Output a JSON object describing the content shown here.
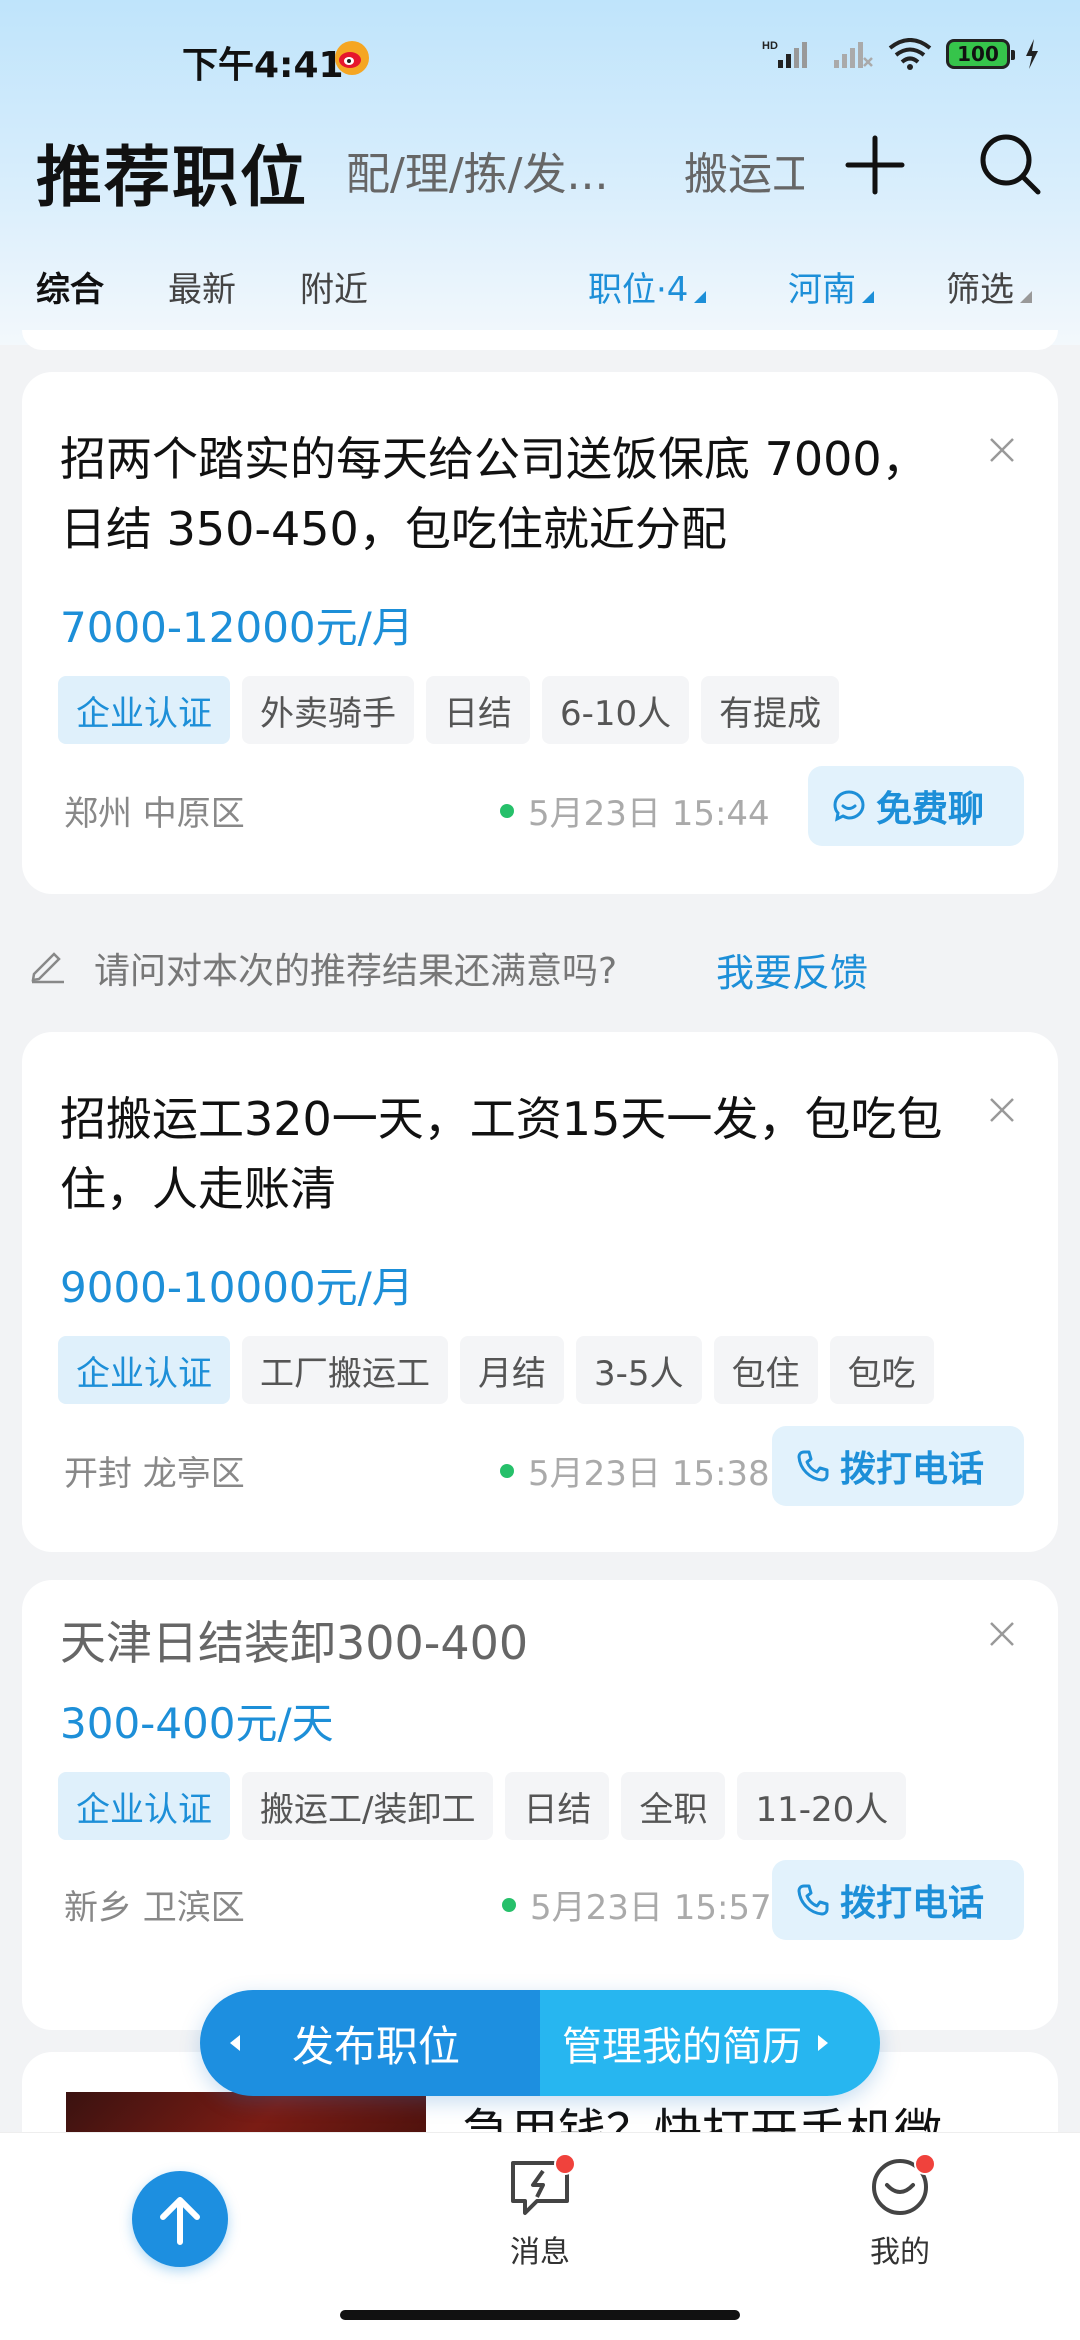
{
  "status_bar": {
    "time": "下午4:41",
    "network_label": "HD",
    "battery": "100",
    "icons": [
      "weibo-icon",
      "signal-icon",
      "signal-x-icon",
      "wifi-icon",
      "battery-icon",
      "charging-icon"
    ]
  },
  "header": {
    "title": "推荐职位",
    "tabs": [
      "配/理/拣/发...",
      "搬运工"
    ],
    "add_icon": "plus-icon",
    "search_icon": "search-icon"
  },
  "filters": {
    "sort_tabs": [
      "综合",
      "最新",
      "附近"
    ],
    "position": "职位·4",
    "region": "河南",
    "filter": "筛选"
  },
  "jobs": [
    {
      "title": "招两个踏实的每天给公司送饭保底 7000，日结 350-450，包吃住就近分配",
      "salary": "7000-12000元/月",
      "tags": [
        "企业认证",
        "外卖骑手",
        "日结",
        "6-10人",
        "有提成"
      ],
      "location": "郑州 中原区",
      "time": "5月23日 15:44",
      "action": "免费聊"
    },
    {
      "title": "招搬运工320一天，工资15天一发，包吃包住，人走账清",
      "salary": "9000-10000元/月",
      "tags": [
        "企业认证",
        "工厂搬运工",
        "月结",
        "3-5人",
        "包住",
        "包吃"
      ],
      "location": "开封 龙亭区",
      "time": "5月23日 15:38",
      "action": "拨打电话"
    },
    {
      "title": "天津日结装卸300-400",
      "salary": "300-400元/天",
      "tags": [
        "企业认证",
        "搬运工/装卸工",
        "日结",
        "全职",
        "11-20人"
      ],
      "location": "新乡 卫滨区",
      "time": "5月23日 15:57",
      "action": "拨打电话"
    }
  ],
  "feedback": {
    "question": "请问对本次的推荐结果还满意吗?",
    "link": "我要反馈"
  },
  "float_bar": {
    "publish": "发布职位",
    "manage": "管理我的简历"
  },
  "ad_card": {
    "title": "急用钱？快打开手机微"
  },
  "bottom_nav": {
    "messages": "消息",
    "mine": "我的"
  },
  "colors": {
    "accent": "#1d8fd8",
    "primary_button": "#1d8fe0",
    "online_dot": "#26c06a",
    "badge": "#f0423c"
  }
}
